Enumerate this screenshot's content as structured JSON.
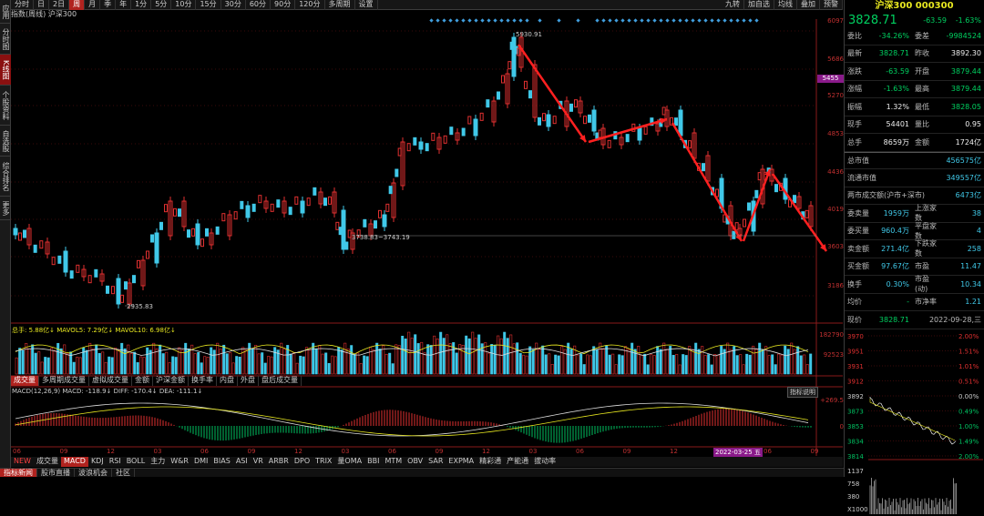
{
  "left_sidebar": [
    "应用",
    "分时图",
    "K线图",
    "个股资料",
    "自选股",
    "综合排名",
    "更多"
  ],
  "topbar": {
    "items": [
      "分时",
      "日",
      "2日",
      "周",
      "月",
      "季",
      "年",
      "1分",
      "5分",
      "10分",
      "15分",
      "30分",
      "60分",
      "90分",
      "120分",
      "多周期",
      "设置"
    ],
    "active": "周",
    "right": [
      "九转",
      "加自选",
      "均线",
      "叠加",
      "预警"
    ]
  },
  "title": "指数(周线) 沪深300",
  "price_axis": [
    "6097",
    "5686",
    "5455",
    "5270",
    "4853",
    "4436",
    "4019",
    "3603",
    "3186"
  ],
  "price_marker": "5455",
  "annotations": {
    "high": "5930.91",
    "low": "2935.83",
    "mid": "3738.83~3743.19"
  },
  "volume": {
    "label": "总手: 5.88亿↓ MAVOL5: 7.29亿↓ MAVOL10: 6.98亿↓",
    "axis": [
      "182790",
      "92523"
    ]
  },
  "chart_tabs": [
    "成交量",
    "多周期成交量",
    "虚拟成交量",
    "金额",
    "沪深金额",
    "换手率",
    "内盘",
    "外盘",
    "盘后成交量"
  ],
  "macd": {
    "label": "MACD(12,26,9) MACD: -118.9↓ DIFF: -170.4↓ DEA: -111.1↓",
    "axis": [
      "+269.5",
      "0"
    ],
    "btn": "指标说明"
  },
  "x_axis": [
    "06",
    "09",
    "12",
    "03",
    "06",
    "09",
    "12",
    "03",
    "06",
    "09",
    "12",
    "03",
    "06",
    "09",
    "12",
    "03",
    "06",
    "09"
  ],
  "x_highlight": "2022-03-25 五",
  "indicators": [
    "成交量",
    "MACD",
    "KDJ",
    "RSI",
    "BOLL",
    "主力",
    "W&R",
    "DMI",
    "BIAS",
    "ASI",
    "VR",
    "ARBR",
    "DPO",
    "TRIX",
    "量OMA",
    "BBI",
    "MTM",
    "OBV",
    "SAR",
    "EXPMA",
    "精彩通",
    "产能通",
    "拔动率"
  ],
  "indicator_active": "MACD",
  "indicator_prefix": "NEW",
  "bottombar": [
    "指标新闻",
    "股市直播",
    "波浪机会",
    "社区"
  ],
  "quote": {
    "name": "沪深300 000300",
    "price": "3828.71",
    "change": "-63.59",
    "pct": "-1.63%",
    "rows": [
      [
        "委比",
        "-34.26%",
        "委差",
        "-9984524"
      ],
      [
        "最新",
        "3828.71",
        "昨收",
        "3892.30"
      ],
      [
        "涨跌",
        "-63.59",
        "开盘",
        "3879.44"
      ],
      [
        "涨幅",
        "-1.63%",
        "最高",
        "3879.44"
      ],
      [
        "振幅",
        "1.32%",
        "最低",
        "3828.05"
      ],
      [
        "现手",
        "54401",
        "量比",
        "0.95"
      ],
      [
        "总手",
        "8659万",
        "金额",
        "1724亿"
      ],
      [
        "总市值",
        "",
        "",
        "456575亿"
      ],
      [
        "流通市值",
        "",
        "",
        "349557亿"
      ],
      [
        "两市成交额(沪市+深市)",
        "",
        "",
        "6473亿"
      ],
      [
        "委卖量",
        "1959万",
        "上涨家数",
        "38"
      ],
      [
        "委买量",
        "960.4万",
        "平盘家数",
        "4"
      ],
      [
        "卖金额",
        "271.4亿",
        "下跌家数",
        "258"
      ],
      [
        "买金额",
        "97.67亿",
        "市盈",
        "11.47"
      ],
      [
        "换手",
        "0.30%",
        "市盈(动)",
        "10.34"
      ],
      [
        "均价",
        "-",
        "市净率",
        "1.21"
      ]
    ],
    "now_label": "现价",
    "now_value": "3828.71",
    "date": "2022-09-28,三"
  },
  "mini": {
    "left": [
      "3970",
      "3951",
      "3931",
      "3912",
      "3892",
      "3873",
      "3853",
      "3834",
      "3814"
    ],
    "right": [
      "2.00%",
      "1.51%",
      "1.01%",
      "0.51%",
      "0.00%",
      "0.49%",
      "1.00%",
      "1.49%",
      "2.00%"
    ],
    "vol": [
      "1137",
      "758",
      "380",
      "X1000"
    ]
  }
}
